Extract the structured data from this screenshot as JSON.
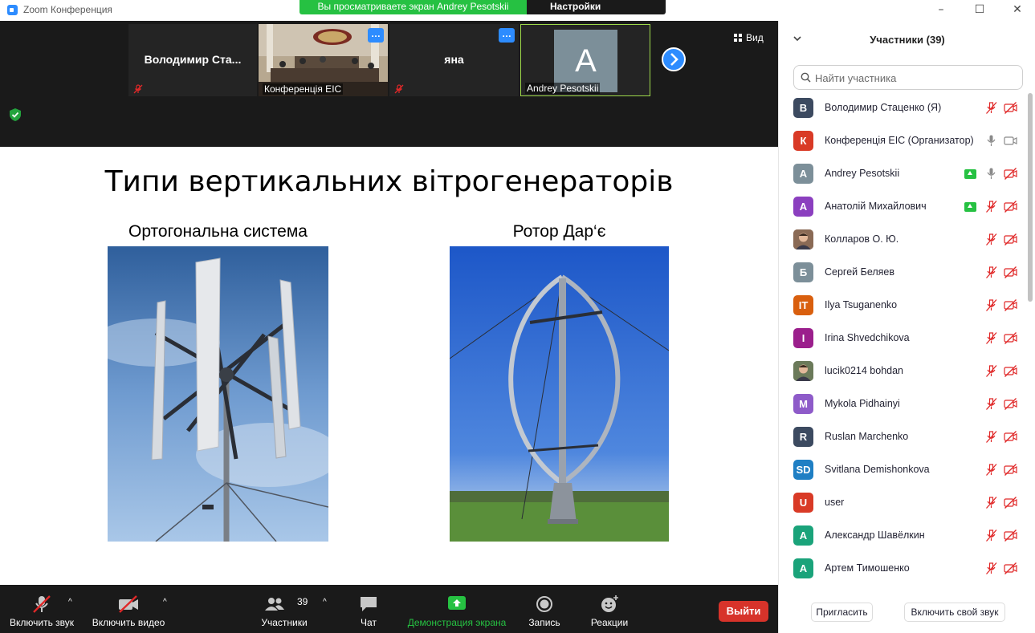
{
  "window": {
    "title": "Zoom Конференция",
    "share_banner": "Вы просматриваете экран Andrey Pesotskii",
    "view_options": "Настройки просмотра",
    "controls": [
      "minimize",
      "maximize",
      "close"
    ]
  },
  "video_strip": {
    "tiles": [
      {
        "name": "Володимир  Ста...",
        "muted": true
      },
      {
        "name": "Конференція ЕІС",
        "muted": true,
        "has_video": true
      },
      {
        "name": "яна",
        "muted": true
      },
      {
        "name": "Andrey Pesotskii",
        "initial": "A",
        "active_speaker": true
      }
    ],
    "more_glyph": "…",
    "next_icon": "chevron-right-icon",
    "view_label": "Вид"
  },
  "slide": {
    "title": "Типи вертикальних вітрогенераторів",
    "left_caption": "Ортогональна система",
    "right_caption": "Ротор Дар‘є"
  },
  "toolbar": {
    "audio": "Включить звук",
    "video": "Включить видео",
    "participants": "Участники",
    "participants_count": "39",
    "chat": "Чат",
    "share": "Демонстрация экрана",
    "record": "Запись",
    "reactions": "Реакции",
    "leave": "Выйти"
  },
  "panel": {
    "title": "Участники (39)",
    "search_placeholder": "Найти участника",
    "invite": "Пригласить",
    "unmute_self": "Включить свой звук",
    "participants": [
      {
        "name": "Володимир Стаценко (Я)",
        "initial": "В",
        "color": "#3c4a60",
        "mic": "muted",
        "cam": "off"
      },
      {
        "name": "Конференція ЕІС (Организатор)",
        "initial": "К",
        "color": "#d93a26",
        "mic": "on",
        "cam": "on"
      },
      {
        "name": "Andrey Pesotskii",
        "initial": "A",
        "color": "#7c8f99",
        "mic": "on",
        "cam": "off",
        "hand": true
      },
      {
        "name": "Анатолій Михайлович",
        "initial": "А",
        "color": "#8b3fbf",
        "mic": "muted",
        "cam": "off",
        "hand": true
      },
      {
        "name": "Колларов О. Ю.",
        "initial": "",
        "color": "#8a6a55",
        "photo": true,
        "mic": "muted",
        "cam": "off"
      },
      {
        "name": "Сергей Беляев",
        "initial": "Б",
        "color": "#7c8f99",
        "mic": "muted",
        "cam": "off"
      },
      {
        "name": "Ilya Tsuganenko",
        "initial": "IT",
        "color": "#d95f0e",
        "mic": "muted",
        "cam": "off"
      },
      {
        "name": "Irina Shvedchikova",
        "initial": "I",
        "color": "#9b1f8c",
        "mic": "muted",
        "cam": "off"
      },
      {
        "name": "lucik0214 bohdan",
        "initial": "",
        "color": "#6b7a5a",
        "photo": true,
        "mic": "muted",
        "cam": "off"
      },
      {
        "name": "Mykola Pidhainyi",
        "initial": "M",
        "color": "#8e5bc9",
        "mic": "muted",
        "cam": "off"
      },
      {
        "name": "Ruslan Marchenko",
        "initial": "R",
        "color": "#3c4a60",
        "mic": "muted",
        "cam": "off"
      },
      {
        "name": "Svitlana Demishonkova",
        "initial": "SD",
        "color": "#1f7fc4",
        "mic": "muted",
        "cam": "off"
      },
      {
        "name": "user",
        "initial": "U",
        "color": "#d93a26",
        "mic": "muted",
        "cam": "off"
      },
      {
        "name": "Александр Шавёлкин",
        "initial": "А",
        "color": "#1aa37a",
        "mic": "muted",
        "cam": "off"
      },
      {
        "name": "Артем Тимошенко",
        "initial": "А",
        "color": "#1aa37a",
        "mic": "muted",
        "cam": "off"
      }
    ]
  },
  "colors": {
    "accent": "#2d8cff",
    "share_green": "#26c142",
    "leave_red": "#d7332a",
    "muted_red": "#e02828"
  }
}
